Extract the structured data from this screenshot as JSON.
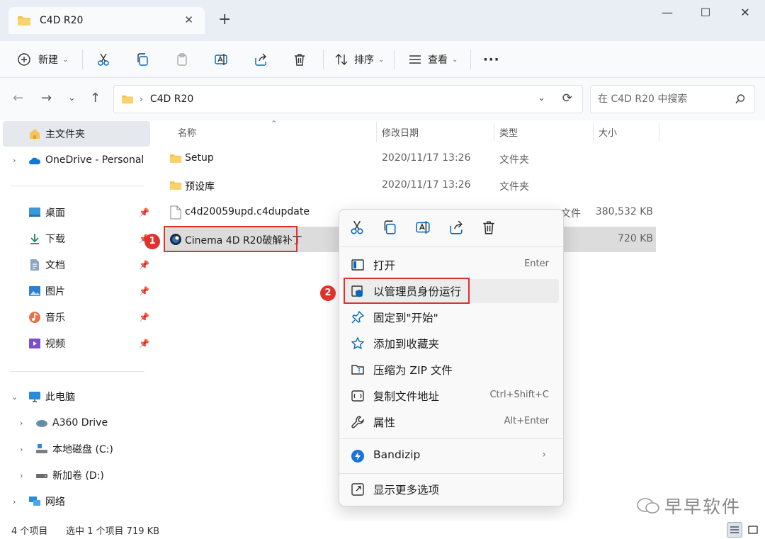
{
  "window": {
    "tab_title": "C4D R20",
    "tab_close": "✕",
    "new_tab": "+",
    "minimize": "—",
    "maximize": "☐",
    "close": "✕"
  },
  "toolbar": {
    "new_label": "新建",
    "sort_label": "排序",
    "view_label": "查看",
    "more": "···"
  },
  "address": {
    "crumb_sep": "›",
    "path": "C4D R20",
    "search_placeholder": "在 C4D R20 中搜索"
  },
  "sidebar": {
    "home": "主文件夹",
    "onedrive": "OneDrive - Personal",
    "quick": [
      {
        "label": "桌面",
        "icon": "desktop-icon"
      },
      {
        "label": "下载",
        "icon": "download-icon"
      },
      {
        "label": "文档",
        "icon": "document-icon"
      },
      {
        "label": "图片",
        "icon": "pictures-icon"
      },
      {
        "label": "音乐",
        "icon": "music-icon"
      },
      {
        "label": "视频",
        "icon": "video-icon"
      }
    ],
    "thispc": "此电脑",
    "drives": [
      "A360 Drive",
      "本地磁盘 (C:)",
      "新加卷 (D:)"
    ],
    "network": "网络"
  },
  "columns": {
    "name": "名称",
    "date": "修改日期",
    "type": "类型",
    "size": "大小"
  },
  "files": [
    {
      "name": "Setup",
      "date": "2020/11/17 13:26",
      "type": "文件夹",
      "size": ""
    },
    {
      "name": "预设库",
      "date": "2020/11/17 13:26",
      "type": "文件夹",
      "size": ""
    },
    {
      "name": "c4d20059upd.c4dupdate",
      "date": "",
      "type": "文件",
      "size": "380,532 KB"
    },
    {
      "name": "Cinema 4D R20破解补丁",
      "date": "",
      "type": "",
      "size": "720 KB"
    }
  ],
  "context_menu": {
    "items": [
      {
        "label": "打开",
        "shortcut": "Enter"
      },
      {
        "label": "以管理员身份运行",
        "shortcut": ""
      },
      {
        "label": "固定到\"开始\"",
        "shortcut": ""
      },
      {
        "label": "添加到收藏夹",
        "shortcut": ""
      },
      {
        "label": "压缩为 ZIP 文件",
        "shortcut": ""
      },
      {
        "label": "复制文件地址",
        "shortcut": "Ctrl+Shift+C"
      },
      {
        "label": "属性",
        "shortcut": "Alt+Enter"
      },
      {
        "label": "Bandizip",
        "shortcut": ""
      },
      {
        "label": "显示更多选项",
        "shortcut": ""
      }
    ]
  },
  "annotations": {
    "badge1": "1",
    "badge2": "2"
  },
  "status": {
    "count": "4 个项目",
    "selection": "选中 1 个项目  719 KB"
  },
  "watermark": "早早软件",
  "colors": {
    "accent": "#0067c0",
    "folder": "#f4c04f",
    "annotation": "#e0322c"
  }
}
